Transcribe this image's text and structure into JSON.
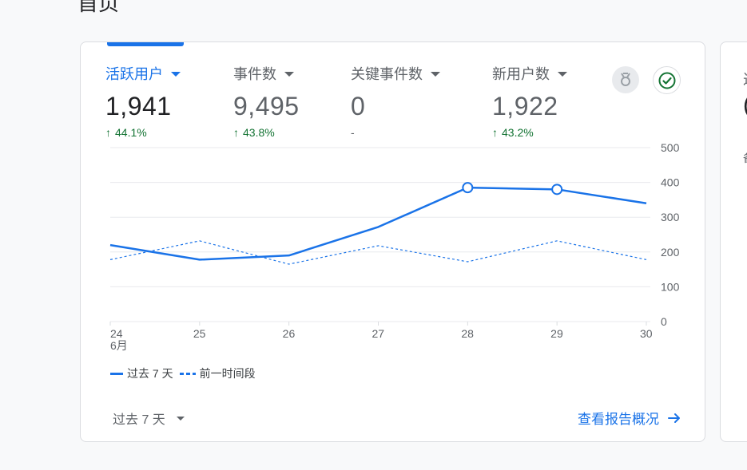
{
  "page": {
    "title": "首页"
  },
  "metrics": [
    {
      "label": "活跃用户",
      "value": "1,941",
      "delta": "44.1%",
      "trend": "up",
      "active": true
    },
    {
      "label": "事件数",
      "value": "9,495",
      "delta": "43.8%",
      "trend": "up",
      "active": false
    },
    {
      "label": "关键事件数",
      "value": "0",
      "delta": "-",
      "trend": "none",
      "active": false
    },
    {
      "label": "新用户数",
      "value": "1,922",
      "delta": "43.2%",
      "trend": "up",
      "active": false
    }
  ],
  "icons": {
    "badge": "medal-icon",
    "check": "check-circle-icon",
    "color_accent": "#1a73e8",
    "color_positive": "#137333"
  },
  "chart_data": {
    "type": "line",
    "categories": [
      "24",
      "25",
      "26",
      "27",
      "28",
      "29",
      "30"
    ],
    "x_sublabel": "6月",
    "ylim": [
      0,
      500
    ],
    "yticks": [
      "0",
      "100",
      "200",
      "300",
      "400",
      "500"
    ],
    "series": [
      {
        "name": "过去 7 天",
        "style": "solid",
        "values": [
          220,
          178,
          190,
          272,
          385,
          380,
          340
        ],
        "markers": [
          false,
          false,
          false,
          false,
          true,
          true,
          false
        ]
      },
      {
        "name": "前一时间段",
        "style": "dashed",
        "values": [
          178,
          232,
          165,
          218,
          172,
          232,
          178
        ]
      }
    ],
    "grid": true,
    "legend_position": "bottom-left"
  },
  "footer": {
    "range_label": "过去 7 天",
    "link_label": "查看报告概况"
  },
  "right_card": {
    "frag1": "过",
    "frag2": "(",
    "frag3": "备"
  }
}
